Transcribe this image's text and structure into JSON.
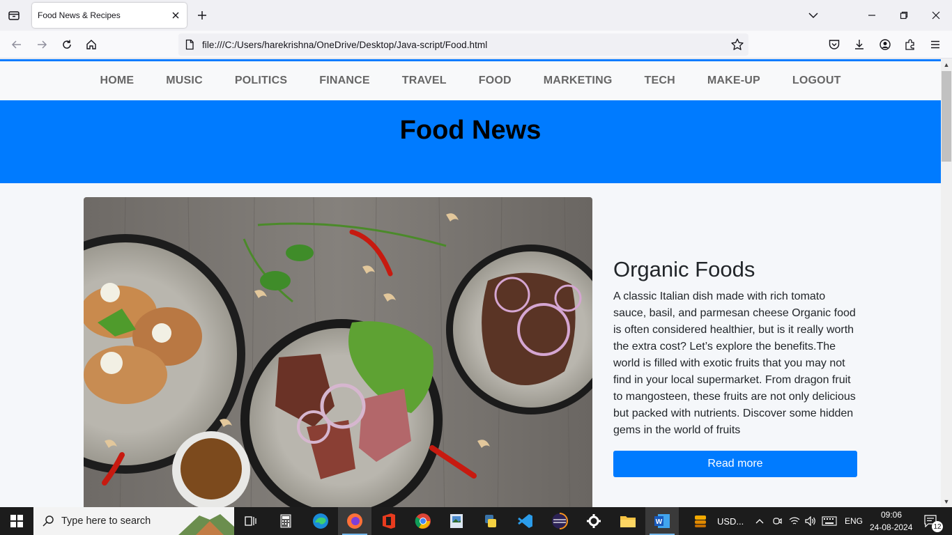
{
  "browser": {
    "tab_title": "Food News & Recipes",
    "url": "file:///C:/Users/harekrishna/OneDrive/Desktop/Java-script/Food.html"
  },
  "site": {
    "nav": [
      "HOME",
      "MUSIC",
      "POLITICS",
      "FINANCE",
      "TRAVEL",
      "FOOD",
      "MARKETING",
      "TECH",
      "MAKE-UP",
      "LOGOUT"
    ],
    "hero_title": "Food News",
    "article": {
      "title": "Organic Foods",
      "text": "A classic Italian dish made with rich tomato sauce, basil, and parmesan cheese Organic food is often considered healthier, but is it really worth the extra cost? Let’s explore the benefits.The world is filled with exotic fruits that you may not find in your local supermarket. From dragon fruit to mangosteen, these fruits are not only delicious but packed with nutrients. Discover some hidden gems in the world of fruits",
      "button": "Read more"
    }
  },
  "taskbar": {
    "search_placeholder": "Type here to search",
    "weather": "USD...",
    "language": "ENG",
    "time": "09:06",
    "date": "24-08-2024",
    "notifications": "12"
  },
  "colors": {
    "accent": "#007bff",
    "browser_accent": "#0a7cff",
    "taskbar": "#1c1c1c"
  }
}
